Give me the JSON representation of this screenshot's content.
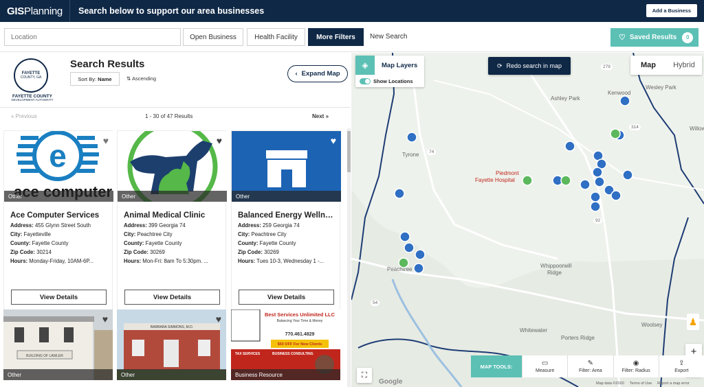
{
  "topbar": {
    "logo_main": "GIS",
    "logo_rest": "Planning",
    "tagline": "Search below to support our area businesses",
    "add_business": "Add a Business"
  },
  "filters": {
    "location_placeholder": "Location",
    "open_business": "Open Business",
    "health_facility": "Health Facility",
    "more_filters": "More Filters",
    "new_search": "New Search",
    "saved_results": "Saved Results",
    "saved_count": "0"
  },
  "org": {
    "seal_line1": "FAYETTE",
    "seal_line2": "COUNTY, GA",
    "name": "FAYETTE COUNTY",
    "sub": "DEVELOPMENT AUTHORITY"
  },
  "results": {
    "title": "Search Results",
    "sort_by_label": "Sort By:",
    "sort_by_value": "Name",
    "order": "Ascending",
    "expand_map": "Expand Map",
    "prev": "Previous",
    "next": "Next",
    "count": "1 - 30 of 47 Results",
    "view_details": "View Details"
  },
  "labels": {
    "address": "Address:",
    "city": "City:",
    "county": "County:",
    "zip": "Zip Code:",
    "hours": "Hours:"
  },
  "cards": [
    {
      "name": "Ace Computer Services",
      "category": "Other",
      "address": "455 Glynn Street South",
      "city": "Fayetteville",
      "county": "Fayette County",
      "zip": "30214",
      "hours": "Monday-Friday, 10AM-6P...",
      "logo_text": "ace computer"
    },
    {
      "name": "Animal Medical Clinic",
      "category": "Other",
      "address": "399 Georgia 74",
      "city": "Peachtree City",
      "county": "Fayette County",
      "zip": "30269",
      "hours": "Mon-Fri: 8am To 5:30pm. ..."
    },
    {
      "name": "Balanced Energy Wellness",
      "category": "Other",
      "address": "259 Georgia 74",
      "city": "Peachtree City",
      "county": "Fayette County",
      "zip": "30269",
      "hours": "Tues 10-3, Wednesday 1 -..."
    },
    {
      "category": "Other",
      "sign_text": "BUILDING OF LAWLER"
    },
    {
      "category": "Other",
      "sign_text": "BARBARA SIMMONS, M.D."
    },
    {
      "category": "Business Resource",
      "flyer_title": "Best Services Unlimited LLC",
      "flyer_sub": "Balancing Your Time & Money",
      "flyer_phone": "770.461.4829",
      "flyer_offer": "$50 OFF For New Clients",
      "flyer_col1": "TAX SERVICES",
      "flyer_col2": "BUSINESS CONSULTING"
    }
  ],
  "map": {
    "map_layers": "Map Layers",
    "show_locations": "Show Locations",
    "redo_search": "Redo search in map",
    "tab_map": "Map",
    "tab_hybrid": "Hybrid",
    "places": [
      "Ashley Park",
      "Kenwood",
      "Wesley Park",
      "Willow",
      "Tyrone",
      "Piedmont",
      "Fayette Hospital",
      "Whippoorwill",
      "Ridge",
      "Whitewater",
      "Porters Ridge",
      "Woolsey",
      "Peachtree City"
    ],
    "road_labels": [
      "74",
      "54",
      "85",
      "92",
      "279",
      "314"
    ],
    "tools_label": "MAP TOOLS:",
    "tools": [
      "Measure",
      "Filter: Area",
      "Filter: Radius",
      "Export"
    ],
    "footer": [
      "Map data ©2020",
      "Terms of Use",
      "Report a map error"
    ],
    "google": "Google"
  },
  "colors": {
    "navy": "#0f2846",
    "teal": "#5cc0b5",
    "pin_blue": "#2f6fc4",
    "pin_green": "#5cb85c"
  }
}
